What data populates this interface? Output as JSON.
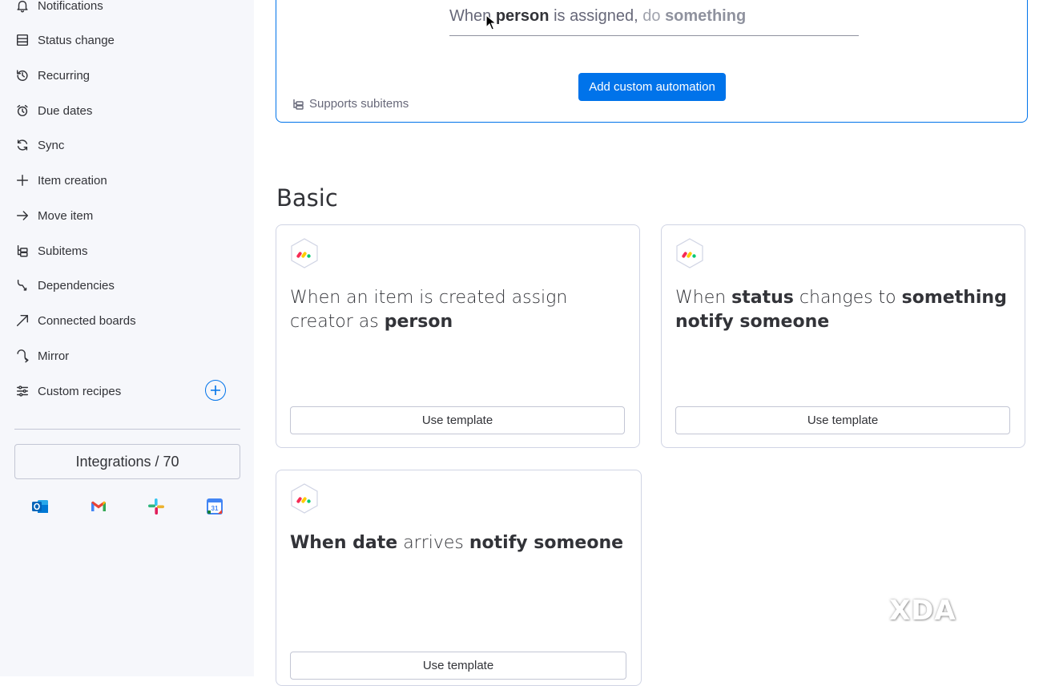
{
  "sidebar": {
    "items": [
      {
        "label": "Notifications",
        "icon": "bell-icon"
      },
      {
        "label": "Status change",
        "icon": "status-list-icon"
      },
      {
        "label": "Recurring",
        "icon": "recurring-icon"
      },
      {
        "label": "Due dates",
        "icon": "alarm-clock-icon"
      },
      {
        "label": "Sync",
        "icon": "sync-icon"
      },
      {
        "label": "Item creation",
        "icon": "plus-icon"
      },
      {
        "label": "Move item",
        "icon": "arrow-right-icon"
      },
      {
        "label": "Subitems",
        "icon": "subitems-icon"
      },
      {
        "label": "Dependencies",
        "icon": "dependency-icon"
      },
      {
        "label": "Connected boards",
        "icon": "arrow-up-right-icon"
      },
      {
        "label": "Mirror",
        "icon": "mirror-icon"
      },
      {
        "label": "Custom recipes",
        "icon": "sliders-icon"
      }
    ],
    "integrations_label": "Integrations / 70",
    "integration_apps": [
      "Outlook",
      "Gmail",
      "Slack",
      "Google Calendar"
    ]
  },
  "custom_automation": {
    "sentence_when": "When",
    "sentence_person": "person",
    "sentence_assigned": "is assigned,",
    "sentence_do": "do",
    "sentence_something": "something",
    "add_button": "Add custom automation",
    "supports_label": "Supports subitems"
  },
  "section": {
    "title": "Basic",
    "use_label": "Use template",
    "cards": [
      {
        "parts": [
          {
            "t": "When an item is created assign creator as ",
            "b": false
          },
          {
            "t": "person",
            "b": true
          }
        ]
      },
      {
        "parts": [
          {
            "t": "When ",
            "b": false
          },
          {
            "t": "status",
            "b": true
          },
          {
            "t": " changes to ",
            "b": false
          },
          {
            "t": "something notify someone",
            "b": true
          }
        ]
      },
      {
        "parts": [
          {
            "t": "When date",
            "b": true
          },
          {
            "t": " arrives ",
            "b": false
          },
          {
            "t": "notify someone",
            "b": true
          }
        ]
      }
    ]
  },
  "watermark": "XDA",
  "colors": {
    "accent": "#0073ea",
    "sidebar_bg": "#f6f7fb",
    "border": "#d0d4e4"
  }
}
